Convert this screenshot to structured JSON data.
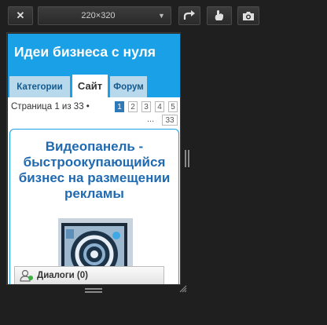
{
  "toolbar": {
    "close_label": "✕",
    "size_value": "220×320",
    "colors": {
      "background": "#1f1f1f",
      "button": "#2f2f2f"
    }
  },
  "site": {
    "title": "Идеи бизнеса с нуля",
    "header_color": "#1aa0e6",
    "tabs": [
      {
        "label": "Категории",
        "active": false
      },
      {
        "label": "Сайт",
        "active": true
      },
      {
        "label": "Форум",
        "active": false
      }
    ]
  },
  "pagination": {
    "label": "Страница 1 из 33 •",
    "pages": [
      "1",
      "2",
      "3",
      "4",
      "5"
    ],
    "current": "1",
    "ellipsis": "...",
    "last": "33"
  },
  "article": {
    "title": "Видеопанель - быстроокупающийся бизнес на размещении рекламы",
    "title_color": "#1f6ab0"
  },
  "chat": {
    "label": "Диалоги (0)",
    "status_color": "#3cb043"
  },
  "icons": [
    "close-icon",
    "chevron-down-icon",
    "rotate-icon",
    "touch-icon",
    "camera-icon",
    "user-icon",
    "resize-handle-icon"
  ]
}
